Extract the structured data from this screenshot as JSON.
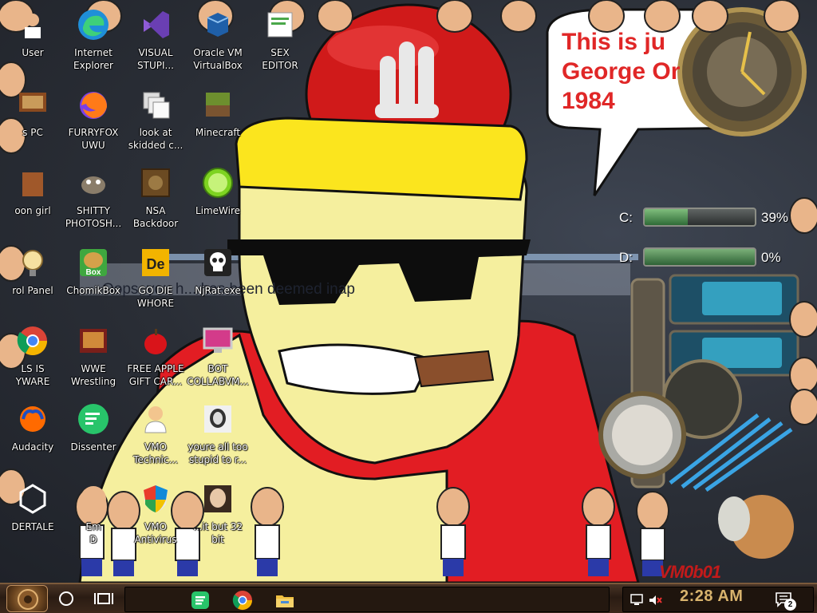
{
  "wallpaper": {
    "speech_bubble": "This is ju\nGeorge Or\n1984",
    "banned_notice": "Oops, you h... has been deemed inap",
    "vm_label": "VM0b01"
  },
  "desktop_icons": [
    {
      "label": "User",
      "icon": "user-folder-icon"
    },
    {
      "label": "Internet\nExplorer",
      "icon": "edge-icon"
    },
    {
      "label": "VISUAL\nSTUPI...",
      "icon": "visual-studio-icon"
    },
    {
      "label": "Oracle VM\nVirtualBox",
      "icon": "virtualbox-icon"
    },
    {
      "label": "SEX\nEDITOR",
      "icon": "editor-icon"
    },
    {
      "label": "s PC",
      "icon": "this-pc-icon"
    },
    {
      "label": "FURRYFOX\nUWU",
      "icon": "firefox-icon"
    },
    {
      "label": "look at\nskidded c...",
      "icon": "copies-icon"
    },
    {
      "label": "Minecraft",
      "icon": "minecraft-icon"
    },
    {
      "label": "oon girl",
      "icon": "bin-icon"
    },
    {
      "label": "SHITTY\nPHOTOSH...",
      "icon": "gimp-icon"
    },
    {
      "label": "NSA\nBackdoor",
      "icon": "nsa-backdoor-icon"
    },
    {
      "label": "LimeWire",
      "icon": "limewire-icon"
    },
    {
      "label": "rol Panel",
      "icon": "control-panel-icon"
    },
    {
      "label": "ChomikBox",
      "icon": "chomikbox-icon"
    },
    {
      "label": "GO DIE\nWHORE",
      "icon": "de-app-icon"
    },
    {
      "label": "NjRat.exe",
      "icon": "skull-icon"
    },
    {
      "label": "LS IS\nYWARE",
      "icon": "chrome-icon"
    },
    {
      "label": "WWE\nWrestling",
      "icon": "wwe-icon"
    },
    {
      "label": "FREE APPLE\nGIFT CAR...",
      "icon": "apple-icon"
    },
    {
      "label": "BOT\nCOLLABVM...",
      "icon": "bot-monitor-icon"
    },
    {
      "label": "Audacity",
      "icon": "audacity-icon"
    },
    {
      "label": "Dissenter",
      "icon": "dissenter-icon"
    },
    {
      "label": "VMO\nTechnic...",
      "icon": "technician-icon"
    },
    {
      "label": "youre all too\nstupid to r...",
      "icon": "portrait-icon"
    },
    {
      "label": "DERTALE",
      "icon": "unity-icon"
    },
    {
      "label": "Em\nD",
      "icon": "emu-icon"
    },
    {
      "label": "VMO\nAntivirus",
      "icon": "shield-icon"
    },
    {
      "label": "...it but 32\nbit",
      "icon": "lady-portrait-icon"
    }
  ],
  "disk_widget": {
    "drives": [
      {
        "letter": "C:",
        "usage_pct": 39,
        "usage_text": "39%"
      },
      {
        "letter": "D:",
        "usage_pct": 0,
        "usage_text": "0%"
      }
    ]
  },
  "taskbar": {
    "pinned": [
      "dissenter-icon",
      "chrome-icon",
      "file-explorer-icon"
    ],
    "clock": "2:28 AM",
    "notification_count": "2"
  },
  "colors": {
    "speech_text": "#e02727",
    "clock": "#d8b36d",
    "taskbar": "#2a1c13"
  }
}
